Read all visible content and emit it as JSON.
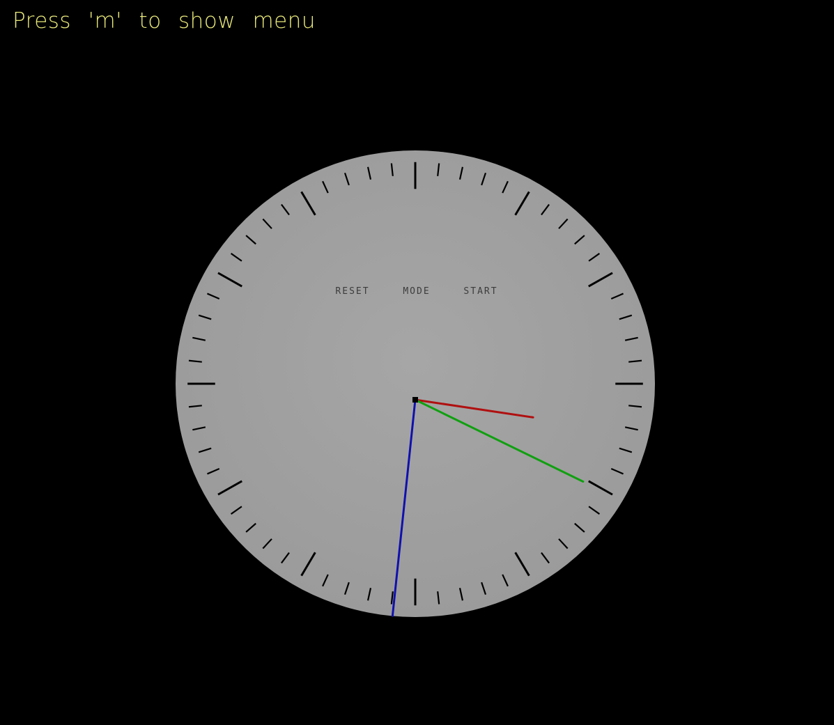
{
  "hint_text": "Press 'm' to show menu",
  "buttons": {
    "reset": "RESET",
    "mode": "MODE",
    "start": "START"
  },
  "clock": {
    "tick_count": 60,
    "major_tick_every": 5,
    "hands": {
      "hour": {
        "color": "#b01010",
        "angle_deg": 98.5
      },
      "minute": {
        "color": "#10a010",
        "angle_deg": 116.0
      },
      "second": {
        "color": "#1010b0",
        "angle_deg": 186.0
      }
    }
  },
  "colors": {
    "background": "#000000",
    "dial_face": "#a0a0a0",
    "ticks": "#000000",
    "hint_text": "#e8e87a"
  }
}
